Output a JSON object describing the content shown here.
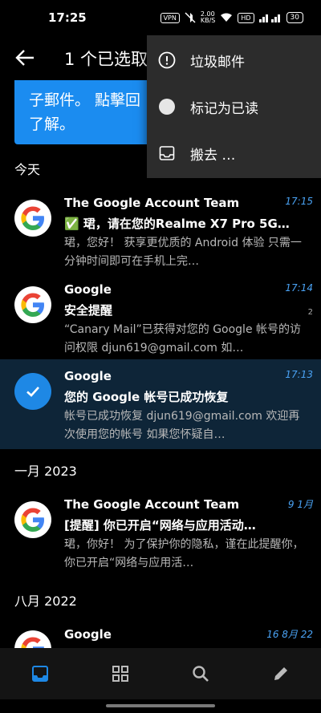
{
  "status": {
    "time": "17:25",
    "vpn": "VPN",
    "speed": "2.00\nKB/S",
    "hd": "HD",
    "battery": "30"
  },
  "appbar": {
    "title": "1 个已选取"
  },
  "banner": {
    "line1": "子郵件。 點擊回",
    "line2": "了解。"
  },
  "menu": {
    "items": [
      {
        "label": "垃圾邮件",
        "icon": "alert-circle-icon"
      },
      {
        "label": "标记为已读",
        "icon": "filled-circle-icon"
      },
      {
        "label": "搬去 …",
        "icon": "inbox-tray-icon"
      }
    ]
  },
  "sections": {
    "today": "今天",
    "jan": "一月 2023",
    "aug": "八月 2022"
  },
  "emails": [
    {
      "sender": "The Google Account Team",
      "time": "17:15",
      "subject": "✅ 珺，请在您的Realme X7 Pro 5G…",
      "preview": "珺，您好！ 获享更优质的 Android 体验 只需一分钟时间即可在手机上完…"
    },
    {
      "sender": "Google",
      "time": "17:14",
      "subject": "安全提醒",
      "count": "2",
      "preview": "“Canary Mail”已获得对您的 Google 帐号的访问权限 djun619@gmail.com 如…"
    },
    {
      "sender": "Google",
      "time": "17:13",
      "subject": "您的 Google 帐号已成功恢复",
      "preview": "帐号已成功恢复 djun619@gmail.com 欢迎再次使用您的帐号 如果您怀疑自…"
    },
    {
      "sender": "The Google Account Team",
      "time": "9 1月",
      "subject": "[提醒] 你已开启“网络与应用活动…",
      "preview": "珺，你好！ 为了保护你的隐私，谨在此提醒你，你已开启“网络与应用活…"
    },
    {
      "sender": "Google",
      "time": "16 8月 22",
      "subject": "",
      "preview": ""
    }
  ],
  "colors": {
    "accent": "#1b8cf0",
    "selected_row": "#0e2538",
    "time": "#4aa3f5"
  }
}
